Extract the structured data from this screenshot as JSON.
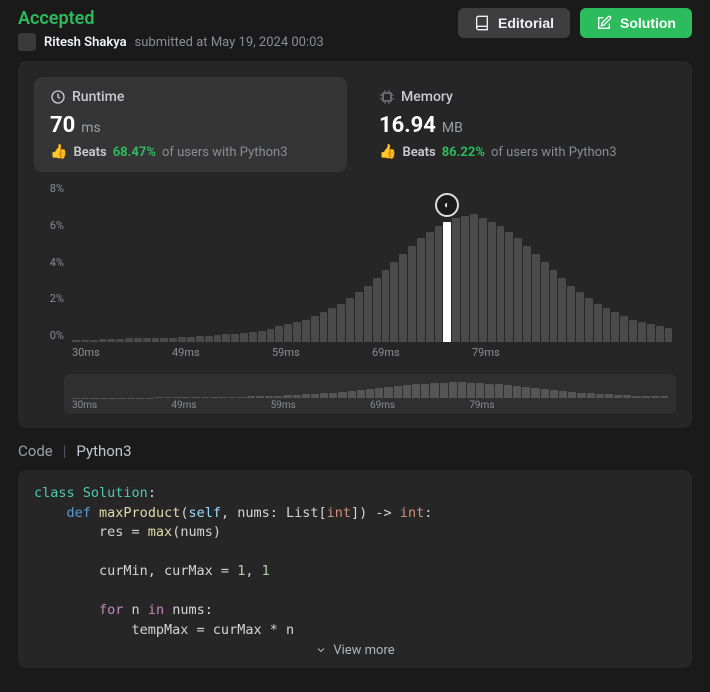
{
  "header": {
    "status": "Accepted",
    "username": "Ritesh Shakya",
    "submitted_prefix": "submitted at",
    "submitted_time": "May 19, 2024 00:03",
    "buttons": {
      "editorial": "Editorial",
      "solution": "Solution"
    }
  },
  "metrics": {
    "runtime": {
      "label": "Runtime",
      "value": "70",
      "unit": "ms",
      "beats_label": "Beats",
      "beats_pct": "68.47%",
      "beats_rest": "of users with Python3"
    },
    "memory": {
      "label": "Memory",
      "value": "16.94",
      "unit": "MB",
      "beats_label": "Beats",
      "beats_pct": "86.22%",
      "beats_rest": "of users with Python3"
    }
  },
  "chart_data": {
    "type": "bar",
    "ylabel": "%",
    "ylim": [
      0,
      8
    ],
    "yticks": [
      "8%",
      "6%",
      "4%",
      "2%",
      "0%"
    ],
    "xticks": [
      "30ms",
      "49ms",
      "59ms",
      "69ms",
      "79ms",
      ""
    ],
    "marker_x": "70ms",
    "values_pct": [
      0.1,
      0.1,
      0.1,
      0.15,
      0.15,
      0.15,
      0.2,
      0.2,
      0.2,
      0.2,
      0.2,
      0.2,
      0.25,
      0.25,
      0.3,
      0.3,
      0.35,
      0.4,
      0.4,
      0.45,
      0.5,
      0.55,
      0.65,
      0.8,
      0.9,
      1.0,
      1.1,
      1.3,
      1.5,
      1.7,
      1.9,
      2.2,
      2.5,
      2.8,
      3.2,
      3.6,
      4.0,
      4.4,
      4.8,
      5.2,
      5.5,
      5.8,
      6.0,
      6.2,
      6.3,
      6.4,
      6.2,
      6.0,
      5.8,
      5.5,
      5.2,
      4.8,
      4.4,
      4.0,
      3.6,
      3.2,
      2.8,
      2.5,
      2.2,
      1.9,
      1.7,
      1.5,
      1.3,
      1.1,
      1.0,
      0.9,
      0.8,
      0.7
    ],
    "highlight_index": 42,
    "mini_xticks": [
      "30ms",
      "49ms",
      "59ms",
      "69ms",
      "79ms",
      ""
    ],
    "mini_values_pct": [
      0.1,
      0.15,
      0.15,
      0.2,
      0.2,
      0.2,
      0.2,
      0.2,
      0.2,
      0.25,
      0.25,
      0.3,
      0.3,
      0.35,
      0.4,
      0.4,
      0.45,
      0.5,
      0.55,
      0.65,
      0.8,
      0.9,
      1.0,
      1.1,
      1.3,
      1.5,
      1.7,
      1.9,
      2.2,
      2.5,
      2.8,
      3.2,
      3.6,
      4.0,
      4.4,
      4.8,
      5.2,
      5.5,
      5.8,
      6.0,
      6.2,
      6.3,
      6.4,
      6.2,
      6.0,
      5.8,
      5.5,
      5.2,
      4.8,
      4.4,
      4.0,
      3.6,
      3.2,
      2.8,
      2.5,
      2.2,
      1.9,
      1.7,
      1.5,
      1.3,
      1.1,
      1.0,
      0.9,
      0.8,
      0.7
    ]
  },
  "code": {
    "tab_label": "Code",
    "language": "Python3",
    "view_more": "View more",
    "tokens": [
      [
        "k-class",
        "class"
      ],
      [
        "",
        " "
      ],
      [
        "k-type",
        "Solution"
      ],
      [
        "",
        ":"
      ],
      [
        "nl",
        ""
      ],
      [
        "",
        "    "
      ],
      [
        "k-def",
        "def"
      ],
      [
        "",
        " "
      ],
      [
        "k-fn",
        "maxProduct"
      ],
      [
        "",
        "("
      ],
      [
        "k-self",
        "self"
      ],
      [
        "",
        ", nums: List["
      ],
      [
        "k-int",
        "int"
      ],
      [
        "",
        "]) -> "
      ],
      [
        "k-int",
        "int"
      ],
      [
        "",
        ":"
      ],
      [
        "nl",
        ""
      ],
      [
        "",
        "        res = "
      ],
      [
        "k-builtin",
        "max"
      ],
      [
        "",
        "(nums)"
      ],
      [
        "nl",
        ""
      ],
      [
        "nl",
        ""
      ],
      [
        "",
        "        curMin, curMax = "
      ],
      [
        "k-num",
        "1"
      ],
      [
        "",
        ", "
      ],
      [
        "k-num",
        "1"
      ],
      [
        "nl",
        ""
      ],
      [
        "nl",
        ""
      ],
      [
        "",
        "        "
      ],
      [
        "k-for",
        "for"
      ],
      [
        "",
        " n "
      ],
      [
        "k-for",
        "in"
      ],
      [
        "",
        " nums:"
      ],
      [
        "nl",
        ""
      ],
      [
        "",
        "            tempMax = curMax * n"
      ],
      [
        "nl",
        ""
      ]
    ]
  }
}
